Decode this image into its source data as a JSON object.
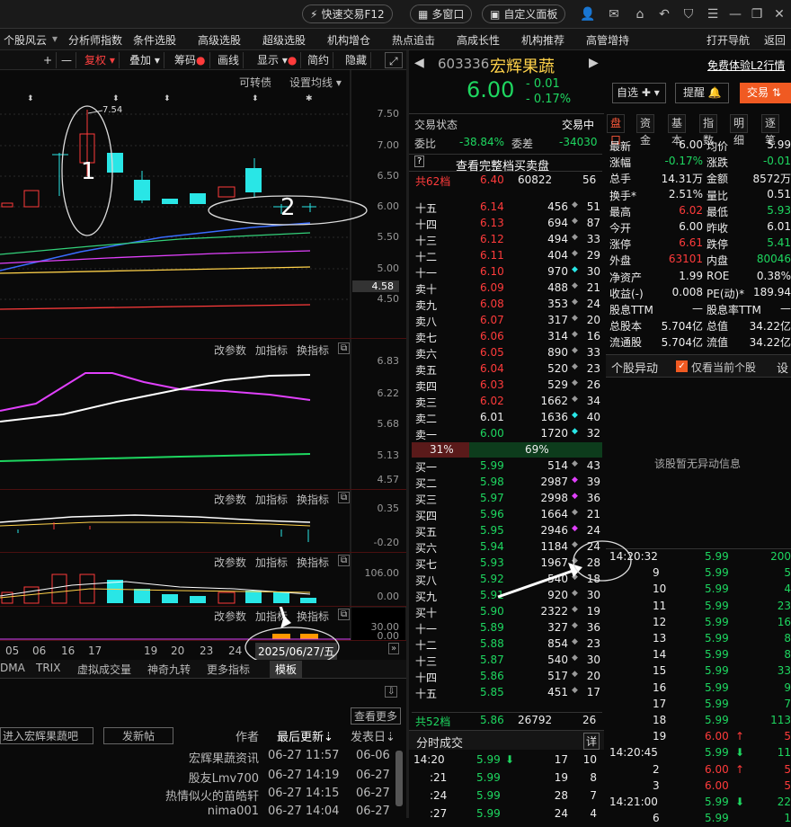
{
  "titlebar": {
    "quick_trade": "快速交易F12",
    "multi_window": "多窗口",
    "custom_panel": "自定义面板"
  },
  "menu": [
    "个股风云",
    "分析师指数",
    "条件选股",
    "高级选股",
    "超级选股",
    "机构增仓",
    "热点追击",
    "高成长性",
    "机构推荐",
    "高管增持"
  ],
  "menu_right": {
    "nav": "打开导航",
    "back": "返回"
  },
  "chart_toolbar": {
    "plus": "+",
    "minus": "—",
    "fq": "复权",
    "overlay": "叠加",
    "chip": "筹码",
    "draw": "画线",
    "display": "显示",
    "simple": "简约",
    "hide": "隐藏"
  },
  "main_pane": {
    "convertible": "可转债",
    "ma_setting": "设置均线",
    "high_label": "7.54",
    "anno1": "1",
    "anno2": "2",
    "y": [
      "7.50",
      "7.00",
      "6.50",
      "6.00",
      "5.50",
      "5.00",
      "4.50"
    ],
    "cur": "4.58"
  },
  "ind_pane": {
    "change_param": "改参数",
    "add_ind": "加指标",
    "swap_ind": "换指标"
  },
  "pane2_y": [
    "6.83",
    "6.22",
    "5.68",
    "5.13",
    "4.57"
  ],
  "pane3_y": [
    "0.35",
    "-0.20"
  ],
  "pane4_y": [
    "106.00",
    "0.00"
  ],
  "pane5_y": [
    "30.00",
    "0.00"
  ],
  "x_axis": [
    "05",
    "06",
    "16",
    "17",
    "19",
    "20",
    "23",
    "24"
  ],
  "x_date": "2025/06/27/五",
  "ind_tabs": [
    "DMA",
    "TRIX",
    "虚拟成交量",
    "神奇九转",
    "更多指标",
    "模板"
  ],
  "news": {
    "more": "查看更多",
    "enter_bar": "进入宏辉果蔬吧",
    "post": "发新帖",
    "author": "作者",
    "last_update": "最后更新",
    "post_date": "发表日",
    "rows": [
      {
        "a": "宏辉果蔬资讯",
        "u": "06-27 11:57",
        "d": "06-06"
      },
      {
        "a": "股友Lmv700",
        "u": "06-27 14:19",
        "d": "06-27"
      },
      {
        "a": "热情似火的苗皓轩",
        "u": "06-27 14:15",
        "d": "06-27"
      },
      {
        "a": "nima001",
        "u": "06-27 14:04",
        "d": "06-27"
      }
    ]
  },
  "stock": {
    "code": "603336",
    "name": "宏辉果蔬",
    "price": "6.00",
    "change": "- 0.01",
    "pct": "- 0.17%",
    "l2": "免费体验L2行情",
    "watch": "自选",
    "alert": "提醒",
    "trade": "交易"
  },
  "book_head": {
    "status": "交易状态",
    "status_val": "交易中",
    "wb": "委比",
    "wb_val": "-38.84%",
    "wc": "委差",
    "wc_val": "-34030",
    "full": "查看完整档买卖盘",
    "sell_total_label": "共62档",
    "sell_total_p": "6.40",
    "sell_total_v": "60822",
    "sell_total_n": "56"
  },
  "asks": [
    [
      "十五",
      "6.14",
      "456",
      "◆",
      "51"
    ],
    [
      "十四",
      "6.13",
      "694",
      "◆",
      "87"
    ],
    [
      "十三",
      "6.12",
      "494",
      "◆",
      "33"
    ],
    [
      "十二",
      "6.11",
      "404",
      "◆",
      "29"
    ],
    [
      "十一",
      "6.10",
      "970",
      "◆",
      "30"
    ],
    [
      "卖十",
      "6.09",
      "488",
      "◆",
      "21"
    ],
    [
      "卖九",
      "6.08",
      "353",
      "◆",
      "24"
    ],
    [
      "卖八",
      "6.07",
      "317",
      "◆",
      "20"
    ],
    [
      "卖七",
      "6.06",
      "314",
      "◆",
      "16"
    ],
    [
      "卖六",
      "6.05",
      "890",
      "◆",
      "33"
    ],
    [
      "卖五",
      "6.04",
      "520",
      "◆",
      "23"
    ],
    [
      "卖四",
      "6.03",
      "529",
      "◆",
      "26"
    ],
    [
      "卖三",
      "6.02",
      "1662",
      "◆",
      "34"
    ],
    [
      "卖二",
      "6.01",
      "1636",
      "◆",
      "40"
    ],
    [
      "卖一",
      "6.00",
      "1720",
      "◆",
      "32"
    ]
  ],
  "ratio": {
    "sell": "31%",
    "buy": "69%"
  },
  "bids": [
    [
      "买一",
      "5.99",
      "514",
      "◆",
      "43"
    ],
    [
      "买二",
      "5.98",
      "2987",
      "◆",
      "39"
    ],
    [
      "买三",
      "5.97",
      "2998",
      "◆",
      "36"
    ],
    [
      "买四",
      "5.96",
      "1664",
      "◆",
      "21"
    ],
    [
      "买五",
      "5.95",
      "2946",
      "◆",
      "24"
    ],
    [
      "买六",
      "5.94",
      "1184",
      "◆",
      "24"
    ],
    [
      "买七",
      "5.93",
      "1967",
      "◆",
      "28"
    ],
    [
      "买八",
      "5.92",
      "540",
      "◆",
      "18"
    ],
    [
      "买九",
      "5.91",
      "920",
      "◆",
      "30"
    ],
    [
      "买十",
      "5.90",
      "2322",
      "◆",
      "19"
    ],
    [
      "十一",
      "5.89",
      "327",
      "◆",
      "36"
    ],
    [
      "十二",
      "5.88",
      "854",
      "◆",
      "23"
    ],
    [
      "十三",
      "5.87",
      "540",
      "◆",
      "30"
    ],
    [
      "十四",
      "5.86",
      "517",
      "◆",
      "20"
    ],
    [
      "十五",
      "5.85",
      "451",
      "◆",
      "17"
    ]
  ],
  "buy_total": {
    "label": "共52档",
    "p": "5.86",
    "v": "26792",
    "n": "26"
  },
  "time_sales": {
    "title": "分时成交",
    "detail": "详",
    "rows": [
      [
        "14:20",
        "5.99",
        "⬇",
        "17",
        "10"
      ],
      [
        ":21",
        "5.99",
        "",
        "19",
        "8"
      ],
      [
        ":24",
        "5.99",
        "",
        "28",
        "7"
      ],
      [
        ":27",
        "5.99",
        "",
        "24",
        "4"
      ]
    ]
  },
  "quote_tabs": [
    "盘口",
    "资金",
    "基本",
    "指数",
    "明细",
    "逐笔"
  ],
  "quote": [
    [
      "最新",
      "6.00",
      "均价",
      "5.99"
    ],
    [
      "涨幅",
      "-0.17%",
      "涨跌",
      "-0.01"
    ],
    [
      "总手",
      "14.31万",
      "金额",
      "8572万"
    ],
    [
      "换手*",
      "2.51%",
      "量比",
      "0.51"
    ],
    [
      "最高",
      "6.02",
      "最低",
      "5.93"
    ],
    [
      "今开",
      "6.00",
      "昨收",
      "6.01"
    ],
    [
      "涨停",
      "6.61",
      "跌停",
      "5.41"
    ],
    [
      "外盘",
      "63101",
      "内盘",
      "80046"
    ],
    [
      "净资产",
      "1.99",
      "ROE",
      "0.38%"
    ],
    [
      "收益(-)",
      "0.008",
      "PE(动)*",
      "189.94"
    ],
    [
      "股息TTM",
      "—",
      "股息率TTM",
      "—"
    ],
    [
      "总股本",
      "5.704亿",
      "总值",
      "34.22亿"
    ],
    [
      "流通股",
      "5.704亿",
      "流值",
      "34.22亿"
    ]
  ],
  "abnormal": {
    "title": "个股异动",
    "only_current": "仅看当前个股",
    "setting": "设",
    "empty": "该股暂无异动信息"
  },
  "ticks": [
    [
      "14:20:32",
      "5.99",
      "",
      "200"
    ],
    [
      "9",
      "5.99",
      "",
      "5"
    ],
    [
      "10",
      "5.99",
      "",
      "4"
    ],
    [
      "11",
      "5.99",
      "",
      "23"
    ],
    [
      "12",
      "5.99",
      "",
      "16"
    ],
    [
      "13",
      "5.99",
      "",
      "8"
    ],
    [
      "14",
      "5.99",
      "",
      "8"
    ],
    [
      "15",
      "5.99",
      "",
      "33"
    ],
    [
      "16",
      "5.99",
      "",
      "9"
    ],
    [
      "17",
      "5.99",
      "",
      "7"
    ],
    [
      "18",
      "5.99",
      "",
      "113"
    ],
    [
      "19",
      "6.00",
      "↑",
      "5"
    ],
    [
      "14:20:45",
      "5.99",
      "⬇",
      "11"
    ],
    [
      "2",
      "6.00",
      "↑",
      "5"
    ],
    [
      "3",
      "6.00",
      "",
      "5"
    ],
    [
      "14:21:00",
      "5.99",
      "⬇",
      "22"
    ],
    [
      "6",
      "5.99",
      "",
      "1"
    ]
  ]
}
